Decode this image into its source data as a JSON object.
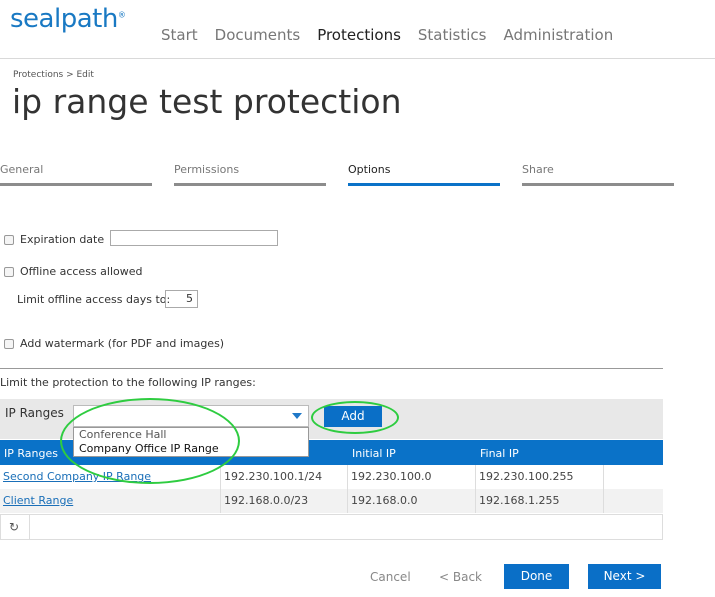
{
  "app": {
    "logo": "sealpath",
    "logo_mark": "®"
  },
  "nav": [
    "Start",
    "Documents",
    "Protections",
    "Statistics",
    "Administration"
  ],
  "breadcrumb": "Protections > Edit",
  "title": "ip range test protection",
  "tabs": [
    "General",
    "Permissions",
    "Options",
    "Share"
  ],
  "options": {
    "expiration_label": "Expiration date",
    "expiration_value": "",
    "offline_label": "Offline access allowed",
    "limit_days_label": "Limit offline access days to:",
    "limit_days_value": "5",
    "watermark_label": "Add watermark (for PDF and images)"
  },
  "ip": {
    "limit_text": "Limit the protection to the following IP ranges:",
    "bar_label": "IP Ranges",
    "add_label": "Add",
    "dropdown_items": [
      "Conference Hall",
      "Company Office IP Range"
    ]
  },
  "table": {
    "headers": [
      "IP Ranges",
      "",
      "Initial IP",
      "Final IP"
    ],
    "rows": [
      [
        "Second Company IP Range",
        "192.230.100.1/24",
        "192.230.100.0",
        "192.230.100.255"
      ],
      [
        "Client Range",
        "192.168.0.0/23",
        "192.168.0.0",
        "192.168.1.255"
      ]
    ]
  },
  "icons": {
    "refresh": "refresh-icon",
    "caret": "caret-down-icon"
  },
  "buttons": {
    "cancel": "Cancel",
    "back": "< Back",
    "done": "Done",
    "next": "Next >"
  },
  "colors": {
    "brand": "#1979c3",
    "accent": "#0a72c8",
    "annotation": "#2ecc40"
  }
}
